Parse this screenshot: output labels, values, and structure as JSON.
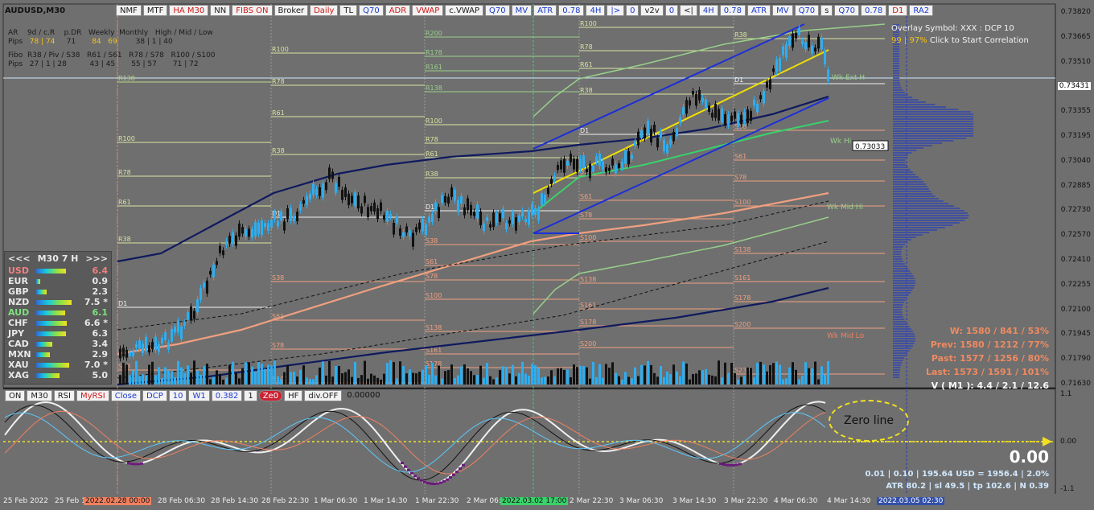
{
  "window": {
    "title": "AUDUSD,M30",
    "icon": "chart-icon"
  },
  "toolbar": {
    "buttons": [
      "NMF",
      "MTF",
      "HA M30",
      "NN",
      "FIBS ON",
      "Broker",
      "Daily",
      "TL",
      "Q70",
      "ADR",
      "VWAP",
      "c.VWAP",
      "Q70",
      "MV",
      "ATR",
      "0.78",
      "4H",
      "|>",
      "0",
      "v2v",
      "0",
      "<|",
      "4H",
      "0.78",
      "ATR",
      "MV",
      "Q70",
      "s",
      "Q70",
      "0.78",
      "D1",
      "RA2"
    ]
  },
  "sub_toolbar": {
    "buttons": [
      "ON",
      "M30",
      "RSI",
      "MyRSI",
      "Close",
      "DCP",
      "10",
      "W1",
      "0.382",
      "1",
      "Ze0",
      "HF",
      "div.OFF"
    ],
    "value": "0.00000"
  },
  "info": {
    "row1_labels": [
      "AR",
      "9d / c.R",
      "p.DR",
      "Weekly",
      "Monthly",
      "High / Mid / Low"
    ],
    "row2_label": "Pips",
    "row2_values": [
      "78 | 74",
      "71",
      "84",
      "69",
      "38 | 1 | 40"
    ],
    "row3_labels": [
      "Fibo",
      "R38 / Piv / S38",
      "R61 / S61",
      "R78 / S78",
      "R100 / S100"
    ],
    "row4_label": "Pips",
    "row4_values": [
      "27 | 1 | 28",
      "43 | 45",
      "55 | 57",
      "71 | 72"
    ]
  },
  "overlay": {
    "line1": "Overlay Symbol: XXX : DCP 10",
    "line2_pct": "99 | 97%",
    "line2_text": "Click to Start Correlation"
  },
  "strength": {
    "title": "M30 7 H",
    "prev": "<<<",
    "next": ">>>",
    "rows": [
      {
        "name": "USD",
        "value": "6.4",
        "color": "#f08080"
      },
      {
        "name": "EUR",
        "value": "0.9",
        "color": "#e8e8e8"
      },
      {
        "name": "GBP",
        "value": "2.3",
        "color": "#e8e8e8"
      },
      {
        "name": "NZD",
        "value": "7.5 *",
        "color": "#e8e8e8"
      },
      {
        "name": "AUD",
        "value": "6.1",
        "color": "#7ee07e"
      },
      {
        "name": "CHF",
        "value": "6.6 *",
        "color": "#e8e8e8"
      },
      {
        "name": "JPY",
        "value": "6.3",
        "color": "#e8e8e8"
      },
      {
        "name": "CAD",
        "value": "3.4",
        "color": "#e8e8e8"
      },
      {
        "name": "MXN",
        "value": "2.9",
        "color": "#e8e8e8"
      },
      {
        "name": "XAU",
        "value": "7.0 *",
        "color": "#e8e8e8"
      },
      {
        "name": "XAG",
        "value": "5.0",
        "color": "#e8e8e8"
      }
    ]
  },
  "price_axis": [
    "0.73820",
    "0.73665",
    "0.73510",
    "0.73431",
    "0.73355",
    "0.73195",
    "0.73040",
    "0.72885",
    "0.72730",
    "0.72570",
    "0.72410",
    "0.72255",
    "0.72100",
    "0.71945",
    "0.71790",
    "0.71630"
  ],
  "current_price": "0.73431",
  "crosshair_price": "0.73033",
  "levels_right": {
    "wk_hi": "Wk Hi",
    "wk_mid_hi": "Wk Mid Hi",
    "wk_mid_lo": "Wk Mid Lo",
    "wk_ext": "Wk Ext H"
  },
  "stats": {
    "w": "W: 1580 / 841 / 53%",
    "prev": "Prev: 1580 / 1212 / 77%",
    "past": "Past: 1577 / 1256 / 80%",
    "last": "Last: 1573 / 1591 / 101%",
    "v": "V ( M1 ): 4.4 / 2.1 / 12.6"
  },
  "osc": {
    "axis": [
      "1.1",
      "0.00",
      "-1.1"
    ],
    "big_value": "0.00",
    "line1": "0.01 | 0.10 | 195.64 USD = 1956.4 | 2.0%",
    "line2": "ATR 80.2 | sl 49.5 | tp 102.6 | N 0.39",
    "annotation": "Zero line"
  },
  "dates": [
    "25 Feb 2022",
    "25 Feb 1",
    "2022.02.28 00:00",
    "28 Feb 06:30",
    "28 Feb 14:30",
    "28 Feb 22:30",
    "1 Mar 06:30",
    "1 Mar 14:30",
    "1 Mar 22:30",
    "2 Mar 06:30",
    "2022.03.02 17:00",
    "2 Mar 22:30",
    "3 Mar 06:30",
    "3 Mar 14:30",
    "3 Mar 22:30",
    "4 Mar 06:30",
    "4 Mar 14:30",
    "2022.03.05 02:30"
  ],
  "pivot_labels": [
    "R100",
    "R78",
    "R61",
    "R38",
    "D1",
    "S38",
    "S61",
    "S78",
    "S100",
    "S138",
    "S161",
    "S178",
    "S200",
    "S238",
    "R138",
    "R161",
    "R178",
    "R200"
  ],
  "colors": {
    "bg": "#6f6f6f",
    "bull": "#2eaef0",
    "bear": "#111111",
    "ma_dark": "#0f1a5e",
    "ma_salmon": "#f0a080",
    "ma_green": "#98d08a",
    "channel": "#1c2fd8",
    "trend": "#f0e000",
    "osc_white": "#f0f0f0",
    "osc_purple": "#6a1a7a"
  }
}
